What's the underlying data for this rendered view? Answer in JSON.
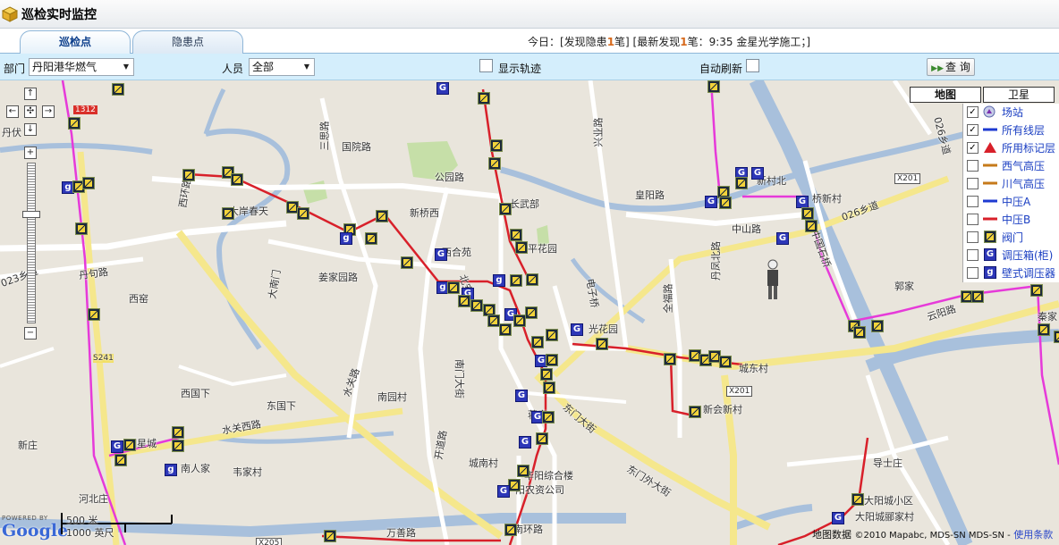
{
  "header": {
    "title": "巡检实时监控"
  },
  "tabs": [
    {
      "label": "巡检点"
    },
    {
      "label": "隐患点"
    }
  ],
  "status": {
    "prefix": "今日：[发现隐患",
    "found_count": "1",
    "mid": "笔] [最新发现",
    "latest_count": "1",
    "suffix": "笔：9:35  金星光学施工；]"
  },
  "filters": {
    "dept_label": "部门",
    "dept_value": "丹阳港华燃气",
    "person_label": "人员",
    "person_value": "全部",
    "show_track_label": "显示轨迹",
    "auto_refresh_label": "自动刷新",
    "query_label": "查 询"
  },
  "map": {
    "type_buttons": [
      {
        "label": "地图"
      },
      {
        "label": "卫星"
      }
    ],
    "layers": [
      {
        "label": "场站",
        "checked": true,
        "symbol": "station-icon"
      },
      {
        "label": "所有线层",
        "checked": true,
        "symbol": "line-blue"
      },
      {
        "label": "所用标记层",
        "checked": true,
        "symbol": "red-triangle-icon"
      },
      {
        "label": "西气高压",
        "checked": false,
        "symbol": "line-orange"
      },
      {
        "label": "川气高压",
        "checked": false,
        "symbol": "line-orange"
      },
      {
        "label": "中压A",
        "checked": false,
        "symbol": "line-blue"
      },
      {
        "label": "中压B",
        "checked": false,
        "symbol": "line-red"
      },
      {
        "label": "阀门",
        "checked": false,
        "symbol": "valve-icon"
      },
      {
        "label": "调压箱(柜)",
        "checked": false,
        "symbol": "regulator-box-icon"
      },
      {
        "label": "壁式调压器",
        "checked": false,
        "symbol": "wall-regulator-icon"
      }
    ],
    "labels": [
      "丹伏",
      "西环路",
      "大岸春天",
      "三思路",
      "国院路",
      "公园路",
      "新桥西",
      "长武部",
      "兴业路",
      "皇阳路",
      "丹凤北路",
      "桥新村",
      "新村北",
      "026乡道",
      "中山路",
      "026乡道",
      "丹句路",
      "023乡道",
      "西窑",
      "姜家园路",
      "大南门",
      "西合苑",
      "北安",
      "平花园",
      "电子桥",
      "全福路",
      "郭家",
      "云阳路",
      "S241",
      "城东村",
      "X201",
      "X201",
      "西国下",
      "南园村",
      "南门大街",
      "东国下",
      "水关路",
      "新会新村",
      "东门外大街",
      "东门大街",
      "水关西路",
      "新庄",
      "南人家",
      "韦家村",
      "城南村",
      "万善路",
      "华阳综合楼",
      "阳农资公司",
      "河北庄",
      "导士庄",
      "大阳城小区",
      "大阳城郦家村",
      "南环路",
      "X205",
      "开道路",
      "光花园",
      "蒋家",
      "秦家",
      "明星城",
      "中国石桥"
    ],
    "scale_metric": "500 米",
    "scale_imperial": "1000 英尺",
    "google_powered": "POWERED BY",
    "google_logo": "Google",
    "copyright_label": "地图数据",
    "copyright_text": "©2010 Mapabc, MDS-SN MDS-SN -",
    "terms_link": "使用条款",
    "road_badge": "1312"
  }
}
